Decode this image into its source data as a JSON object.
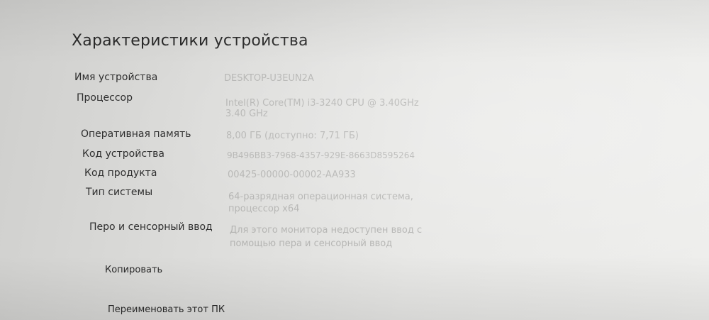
{
  "section": {
    "title": "Характеристики устройства"
  },
  "specs": [
    {
      "label": "Имя устройства",
      "value": "DESKTOP-U3EUN2A",
      "value_line2": ""
    },
    {
      "label": "Процессор",
      "value": "Intel(R) Core(TM) i3-3240 CPU @ 3.40GHz",
      "value_line2": "3.40 GHz"
    },
    {
      "label": "Оперативная память",
      "value": "8,00 ГБ (доступно: 7,71 ГБ)",
      "value_line2": ""
    },
    {
      "label": "Код устройства",
      "value": "9B496BB3-7968-4357-929E-8663D8595264",
      "value_line2": ""
    },
    {
      "label": "Код продукта",
      "value": "00425-00000-00002-AA933",
      "value_line2": ""
    },
    {
      "label": "Тип системы",
      "value": "64-разрядная операционная система,",
      "value_line2": "процессор x64"
    },
    {
      "label": "Перо и сенсорный ввод",
      "value": "Для этого монитора недоступен ввод с",
      "value_line2": "помощью пера и сенсорный ввод"
    }
  ],
  "actions": {
    "copy_label": "Копировать",
    "rename_label": "Переименовать этот ПК"
  }
}
